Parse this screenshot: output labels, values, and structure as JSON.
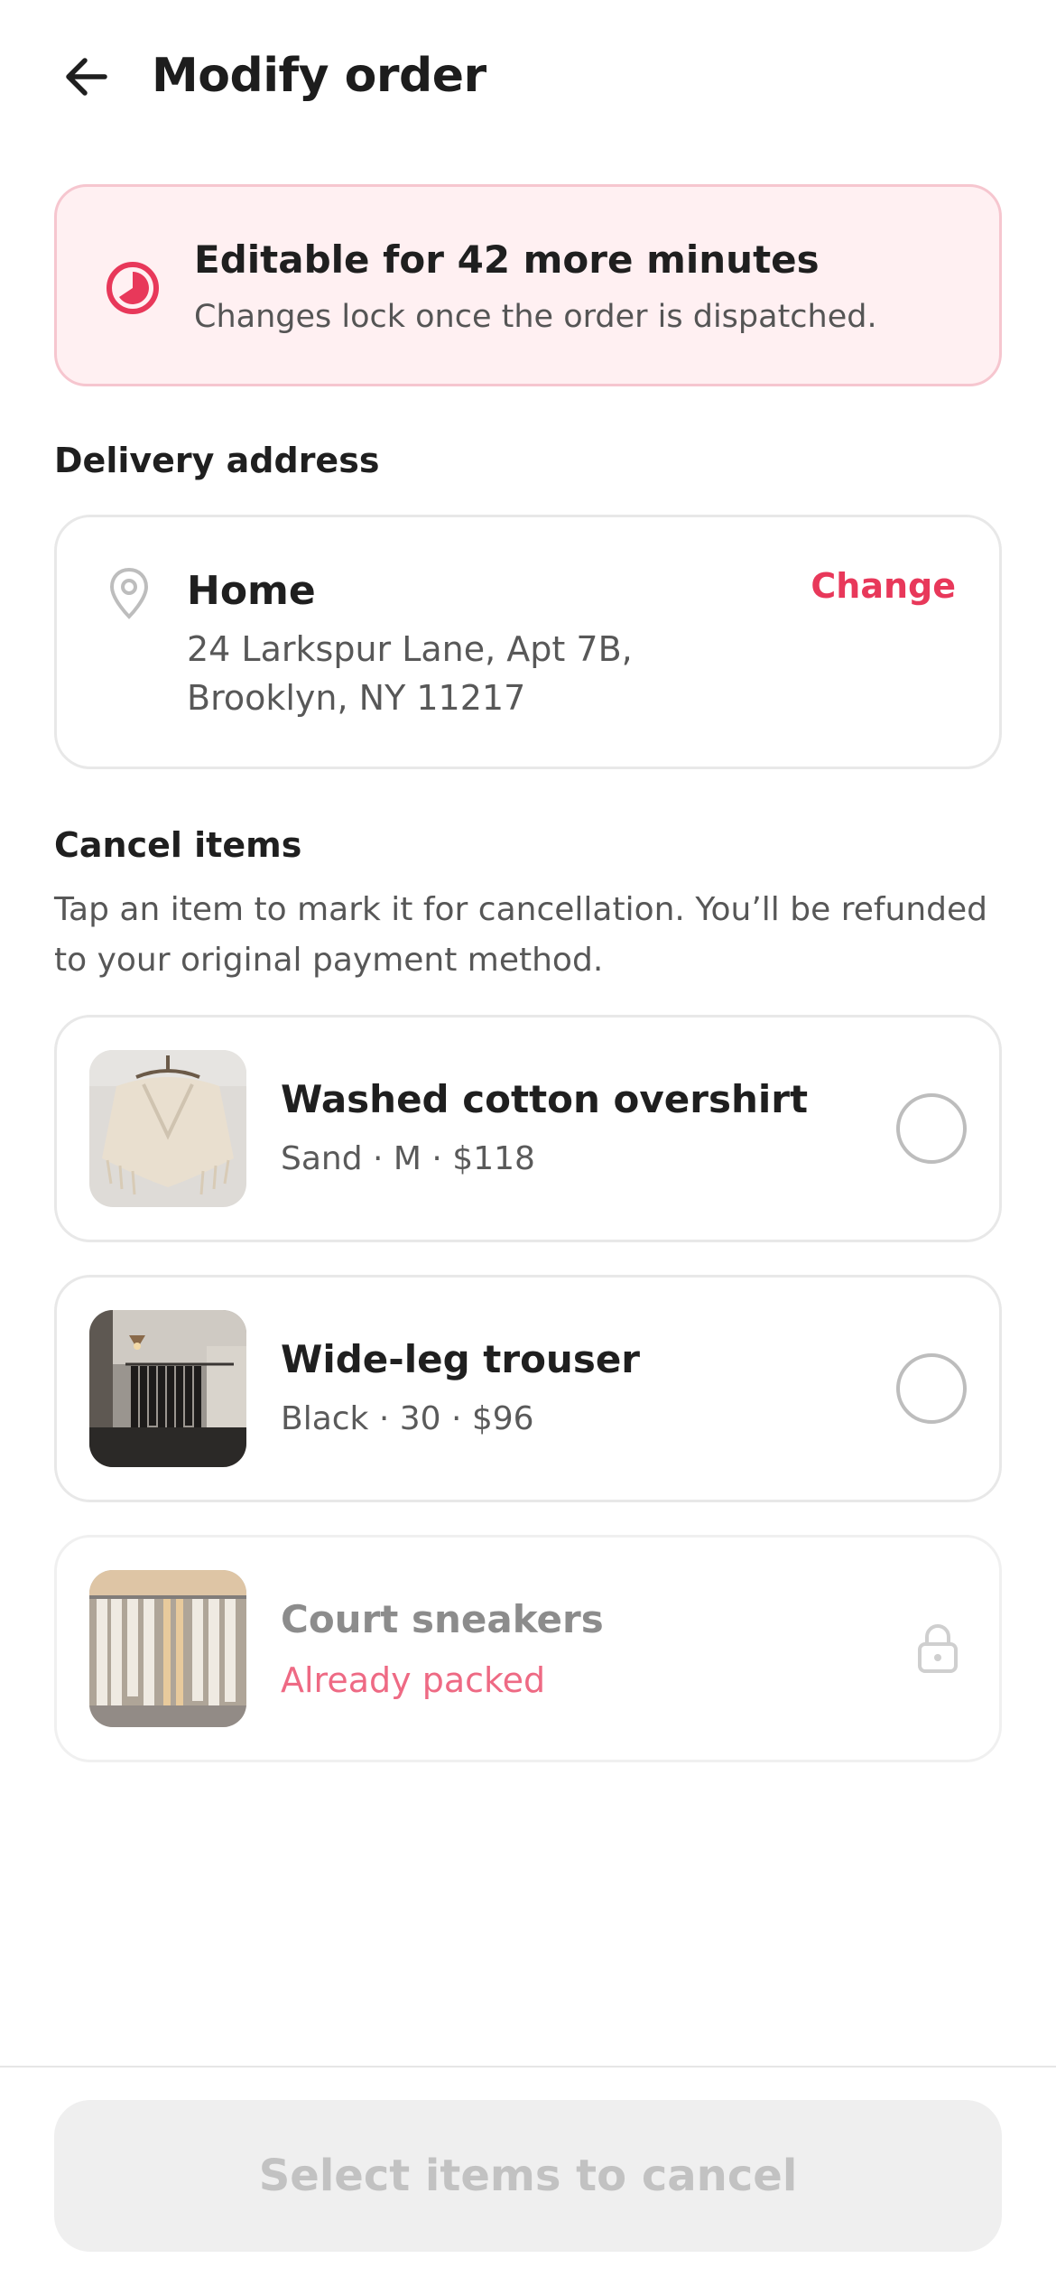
{
  "header": {
    "title": "Modify order",
    "back_icon": "arrow-left-icon"
  },
  "banner": {
    "title": "Editable for 42 more minutes",
    "subtitle": "Changes lock once the order is dispatched.",
    "icon": "timer-icon",
    "accent": "#e8385a",
    "background": "#fff0f2"
  },
  "delivery": {
    "section_label": "Delivery address",
    "name": "Home",
    "line1": "24 Larkspur Lane, Apt 7B,",
    "line2": "Brooklyn, NY 11217",
    "change_label": "Change",
    "icon": "location-pin-icon"
  },
  "cancel": {
    "section_label": "Cancel items",
    "description": "Tap an item to mark it for cancellation. You’ll be refunded to your original payment method.",
    "items": [
      {
        "name": "Washed cotton overshirt",
        "meta": "Sand · M · $118",
        "selectable": true,
        "selected": false
      },
      {
        "name": "Wide-leg trouser",
        "meta": "Black · 30 · $96",
        "selectable": true,
        "selected": false
      },
      {
        "name": "Court sneakers",
        "status": "Already packed",
        "selectable": false,
        "icon": "lock-icon"
      }
    ]
  },
  "footer": {
    "cta_label": "Select items to cancel",
    "cta_enabled": false
  }
}
